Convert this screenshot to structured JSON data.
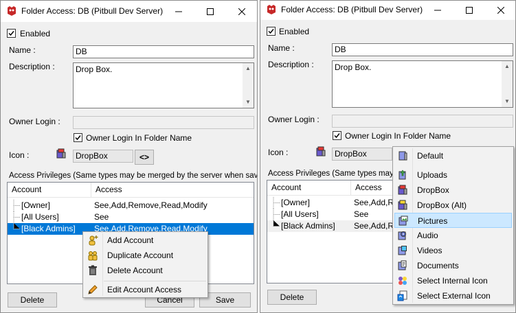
{
  "left": {
    "title": "Folder Access: DB (Pitbull Dev Server)",
    "enabled_label": "Enabled",
    "name_label": "Name :",
    "name_value": "DB",
    "description_label": "Description :",
    "description_value": "Drop Box.",
    "owner_login_label": "Owner Login :",
    "owner_login_value": "",
    "owner_in_folder_label": "Owner Login In Folder Name",
    "icon_label": "Icon :",
    "icon_value": "DropBox",
    "icon_picker_label": "<>",
    "access_label": "Access Privileges (Same types may be merged by the server when saved) :",
    "columns": [
      "Account",
      "Access"
    ],
    "rows": [
      {
        "account": "[Owner]",
        "access": "See,Add,Remove,Read,Modify"
      },
      {
        "account": "[All Users]",
        "access": "See"
      },
      {
        "account": "[Black Admins]",
        "access": "See,Add,Remove,Read,Modify"
      }
    ],
    "delete_label": "Delete",
    "cancel_label": "Cancel",
    "save_label": "Save",
    "context_menu": [
      {
        "label": "Add Account",
        "icon": "add-user-icon"
      },
      {
        "label": "Duplicate Account",
        "icon": "duplicate-users-icon"
      },
      {
        "label": "Delete Account",
        "icon": "trash-icon"
      },
      {
        "label": "Edit Account Access",
        "icon": "pencil-icon"
      }
    ]
  },
  "right": {
    "title": "Folder Access: DB (Pitbull Dev Server)",
    "enabled_label": "Enabled",
    "name_label": "Name :",
    "name_value": "DB",
    "description_label": "Description :",
    "description_value": "Drop Box.",
    "owner_login_label": "Owner Login :",
    "owner_in_folder_label": "Owner Login In Folder Name",
    "icon_label": "Icon :",
    "icon_value": "DropBox",
    "access_label_visible": "Access Privileges (Same types may be",
    "columns": [
      "Account",
      "Access"
    ],
    "rows": [
      {
        "account": "[Owner]",
        "access": "See,Add,Re"
      },
      {
        "account": "[All Users]",
        "access": "See"
      },
      {
        "account": "[Black Admins]",
        "access": "See,Add,Re"
      }
    ],
    "delete_label": "Delete",
    "icon_menu": [
      {
        "label": "Default",
        "icon": "folder-default-icon"
      },
      {
        "label": "Uploads",
        "icon": "folder-uploads-icon"
      },
      {
        "label": "DropBox",
        "icon": "folder-dropbox-icon"
      },
      {
        "label": "DropBox (Alt)",
        "icon": "folder-dropbox-alt-icon"
      },
      {
        "label": "Pictures",
        "icon": "folder-pictures-icon",
        "highlighted": true
      },
      {
        "label": "Audio",
        "icon": "folder-audio-icon"
      },
      {
        "label": "Videos",
        "icon": "folder-videos-icon"
      },
      {
        "label": "Documents",
        "icon": "folder-documents-icon"
      },
      {
        "label": "Select Internal Icon",
        "icon": "internal-icon"
      },
      {
        "label": "Select External Icon",
        "icon": "external-icon"
      }
    ]
  },
  "colors": {
    "selection": "#0078d7",
    "highlight": "#cce8ff",
    "window_bg": "#f0f0f0"
  }
}
